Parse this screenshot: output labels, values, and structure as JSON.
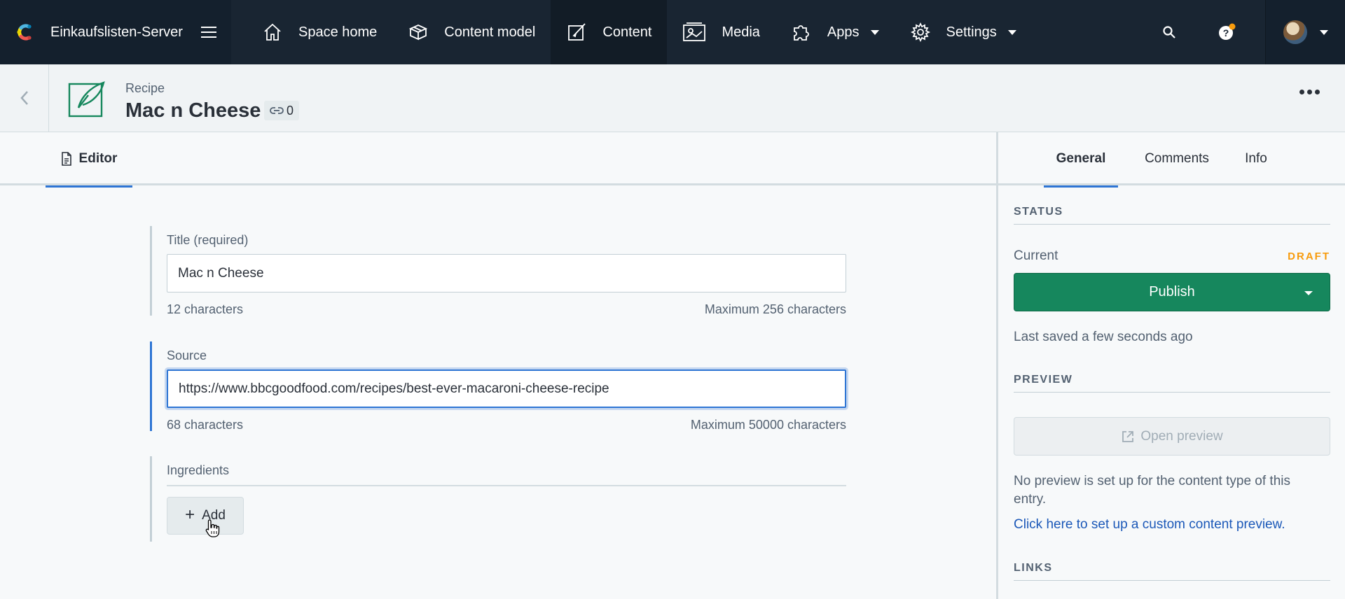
{
  "topnav": {
    "space_name": "Einkaufslisten-Server",
    "items": [
      {
        "label": "Space home",
        "icon": "home-icon"
      },
      {
        "label": "Content model",
        "icon": "content-model-icon"
      },
      {
        "label": "Content",
        "icon": "content-icon",
        "active": true
      },
      {
        "label": "Media",
        "icon": "media-icon"
      },
      {
        "label": "Apps",
        "icon": "apps-icon",
        "dropdown": true
      },
      {
        "label": "Settings",
        "icon": "gear-icon",
        "dropdown": true
      }
    ]
  },
  "entry": {
    "content_type": "Recipe",
    "title": "Mac n Cheese",
    "references_count": "0"
  },
  "editor": {
    "tab_label": "Editor",
    "fields": {
      "title": {
        "label": "Title (required)",
        "value": "Mac n Cheese",
        "count": "12 characters",
        "max": "Maximum 256 characters"
      },
      "source": {
        "label": "Source",
        "value": "https://www.bbcgoodfood.com/recipes/best-ever-macaroni-cheese-recipe",
        "count": "68 characters",
        "max": "Maximum 50000 characters"
      },
      "ingredients": {
        "label": "Ingredients",
        "add_label": "Add"
      }
    }
  },
  "sidebar": {
    "tabs": [
      "General",
      "Comments",
      "Info"
    ],
    "active_tab": "General",
    "status": {
      "heading": "STATUS",
      "current_label": "Current",
      "state": "DRAFT",
      "publish_label": "Publish",
      "saved_text": "Last saved a few seconds ago"
    },
    "preview": {
      "heading": "PREVIEW",
      "button_label": "Open preview",
      "note": "No preview is set up for the content type of this entry.",
      "link": "Click here to set up a custom content preview."
    },
    "links": {
      "heading": "LINKS"
    }
  },
  "colors": {
    "nav_bg": "#192532",
    "accent_blue": "#2e75d4",
    "publish_green": "#16875d",
    "draft_orange": "#f79b0c"
  }
}
